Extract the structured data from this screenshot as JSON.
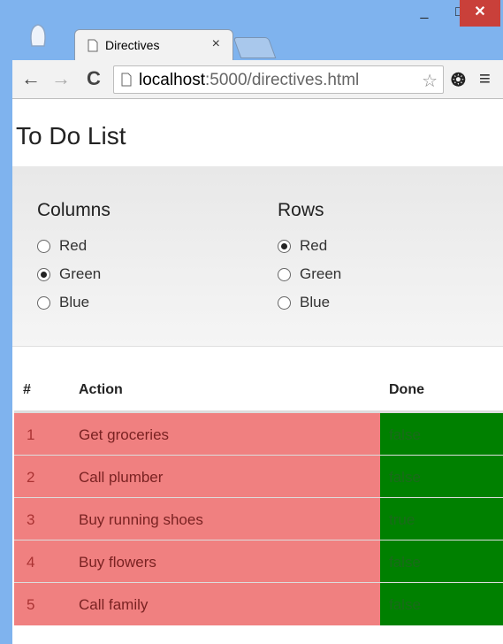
{
  "browser": {
    "tab_title": "Directives",
    "tab_close": "×",
    "url_host": "localhost",
    "url_rest": ":5000/directives.html",
    "window_controls": {
      "minimize": "_",
      "maximize": "□",
      "close": "✕"
    },
    "nav": {
      "back": "←",
      "forward": "→",
      "reload": "C"
    },
    "star_glyph": "☆",
    "menu_glyph": "≡",
    "ext_glyph": "❂"
  },
  "page": {
    "title": "To Do List",
    "columns_group": {
      "title": "Columns",
      "options": [
        {
          "label": "Red",
          "checked": false
        },
        {
          "label": "Green",
          "checked": true
        },
        {
          "label": "Blue",
          "checked": false
        }
      ]
    },
    "rows_group": {
      "title": "Rows",
      "options": [
        {
          "label": "Red",
          "checked": true
        },
        {
          "label": "Green",
          "checked": false
        },
        {
          "label": "Blue",
          "checked": false
        }
      ]
    },
    "table": {
      "headers": [
        "#",
        "Action",
        "Done"
      ],
      "rows": [
        {
          "num": "1",
          "action": "Get groceries",
          "done": "false"
        },
        {
          "num": "2",
          "action": "Call plumber",
          "done": "false"
        },
        {
          "num": "3",
          "action": "Buy running shoes",
          "done": "true"
        },
        {
          "num": "4",
          "action": "Buy flowers",
          "done": "false"
        },
        {
          "num": "5",
          "action": "Call family",
          "done": "false"
        }
      ],
      "row_color": "#f08080",
      "column_color": "#008000"
    }
  }
}
